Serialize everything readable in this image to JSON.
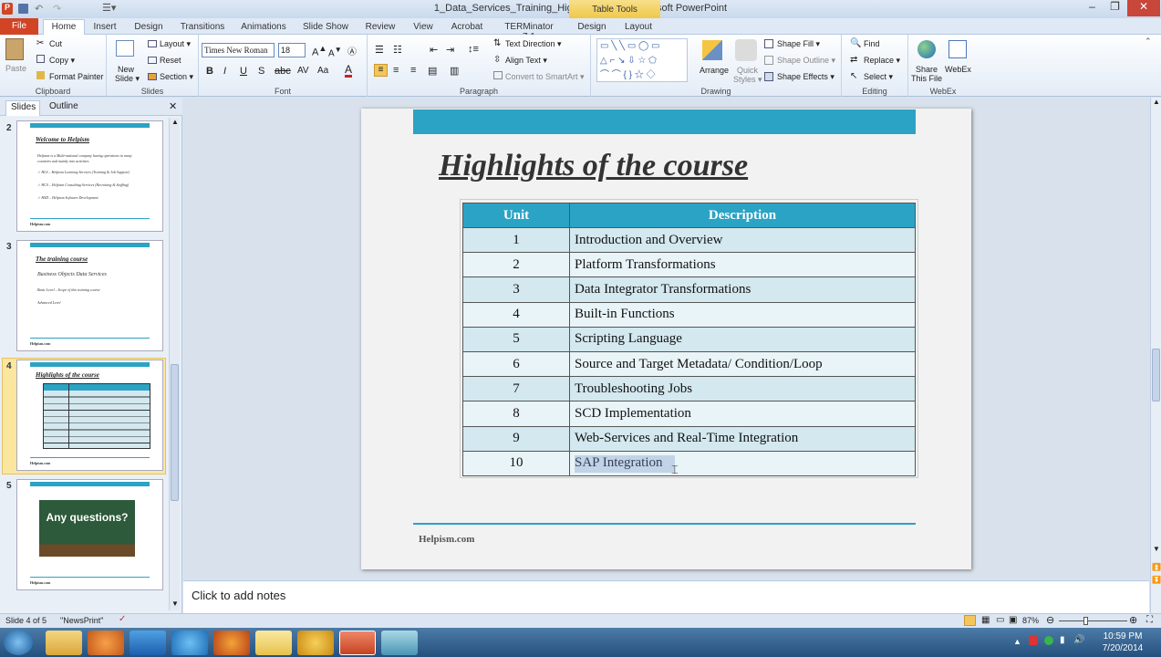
{
  "window": {
    "title": "1_Data_Services_Training_Highlights.pptx - Microsoft PowerPoint",
    "context_tab": "Table Tools",
    "minimize": "–",
    "restore": "❐",
    "close": "✕"
  },
  "tabs": [
    "File",
    "Home",
    "Insert",
    "Design",
    "Transitions",
    "Animations",
    "Slide Show",
    "Review",
    "View",
    "Acrobat",
    "TERMinator 7.1",
    "Design",
    "Layout"
  ],
  "ribbon": {
    "clipboard": {
      "label": "Clipboard",
      "paste": "Paste",
      "cut": "Cut",
      "copy": "Copy ▾",
      "format_painter": "Format Painter"
    },
    "slides": {
      "label": "Slides",
      "new_slide": "New",
      "new_slide2": "Slide ▾",
      "layout": "Layout ▾",
      "reset": "Reset",
      "section": "Section ▾"
    },
    "font": {
      "label": "Font",
      "font_name": "Times New Roman",
      "font_size": "18"
    },
    "paragraph": {
      "label": "Paragraph",
      "text_direction": "Text Direction ▾",
      "align_text": "Align Text ▾",
      "convert_smartart": "Convert to SmartArt ▾"
    },
    "drawing": {
      "label": "Drawing",
      "arrange": "Arrange",
      "quick_styles": "Quick",
      "quick_styles2": "Styles ▾",
      "shape_fill": "Shape Fill ▾",
      "shape_outline": "Shape Outline ▾",
      "shape_effects": "Shape Effects ▾"
    },
    "editing": {
      "label": "Editing",
      "find": "Find",
      "replace": "Replace ▾",
      "select": "Select ▾"
    },
    "webex": {
      "label": "WebEx",
      "share": "Share",
      "share2": "This File",
      "webex": "WebEx"
    }
  },
  "pane": {
    "tab_slides": "Slides",
    "tab_outline": "Outline",
    "thumbs": [
      {
        "num": "2",
        "title": "Welcome to Helpism",
        "lines": [
          "Helpism is a Multi-national company having operations in many",
          "countries and mainly into activities",
          "✓  HLS – Helpism Learning Services (Training & Job Support)",
          "✓  HCS – Helpism Consulting Services (Recruiting & Staffing)",
          "✓  HSD – Helpism Software Development"
        ],
        "footer": "Helpism.com"
      },
      {
        "num": "3",
        "title": "The training course",
        "lines": [
          "Business  Objects  Data  Services",
          "Basic Level – Scope of this training course",
          "Advanced Level"
        ],
        "footer": "Helpism.com"
      },
      {
        "num": "4",
        "title": "Highlights  of the course",
        "footer": "Helpism.com"
      },
      {
        "num": "5",
        "image_text": "Any questions?",
        "footer": "Helpism.com"
      }
    ]
  },
  "slide": {
    "title": "Highlights of the course",
    "footer": "Helpism.com",
    "table": {
      "headers": [
        "Unit",
        "Description"
      ],
      "rows": [
        [
          "1",
          "Introduction and Overview"
        ],
        [
          "2",
          "Platform Transformations"
        ],
        [
          "3",
          "Data Integrator Transformations"
        ],
        [
          "4",
          "Built-in Functions"
        ],
        [
          "5",
          "Scripting Language"
        ],
        [
          "6",
          "Source and Target Metadata/ Condition/Loop"
        ],
        [
          "7",
          "Troubleshooting Jobs"
        ],
        [
          "8",
          "SCD Implementation"
        ],
        [
          "9",
          "Web-Services  and Real-Time Integration"
        ],
        [
          "10",
          "SAP Integration"
        ]
      ]
    }
  },
  "notes": {
    "placeholder": "Click to add notes"
  },
  "status": {
    "slide": "Slide 4 of 5",
    "theme": "\"NewsPrint\"",
    "zoom": "87%"
  },
  "clock": {
    "time": "10:59 PM",
    "date": "7/20/2014"
  },
  "colors": {
    "accent": "#2ba3c4",
    "file_tab": "#d14424"
  }
}
